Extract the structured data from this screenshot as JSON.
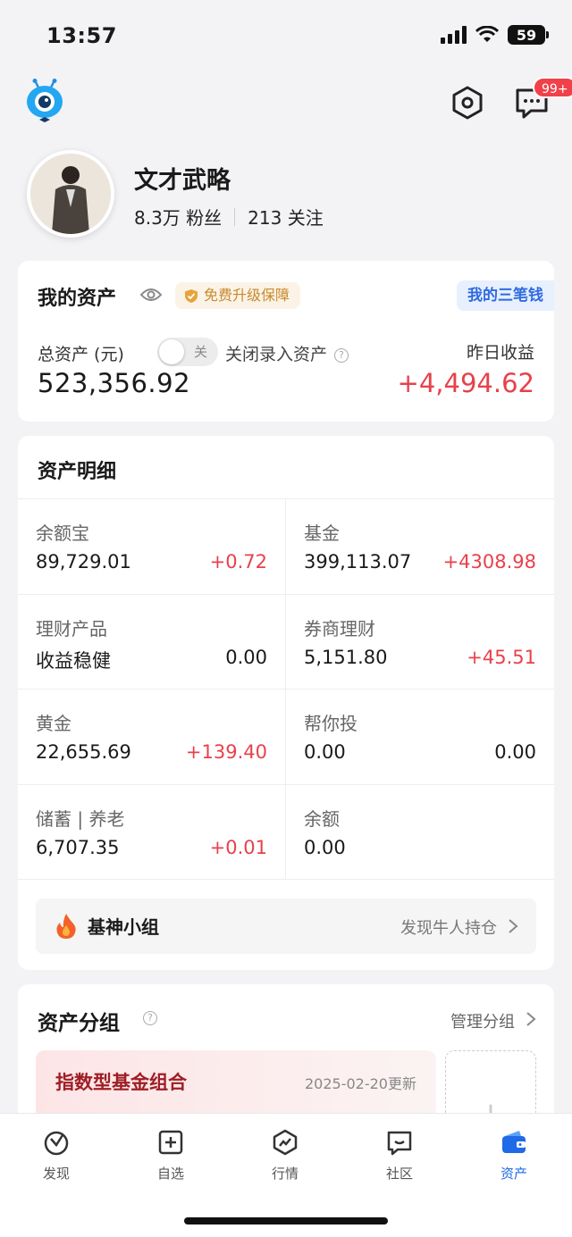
{
  "status_bar": {
    "time": "13:57",
    "battery": "59"
  },
  "header": {
    "message_badge": "99+"
  },
  "profile": {
    "name": "文才武略",
    "fans": "8.3万 粉丝",
    "following": "213 关注"
  },
  "assets": {
    "title": "我的资产",
    "protect_badge": "免费升级保障",
    "three_money": "我的三笔钱",
    "total_label": "总资产 (元)",
    "toggle_text": "关",
    "toggle_label": "关闭录入资产",
    "total_value": "523,356.92",
    "yesterday_label": "昨日收益",
    "yesterday_value": "+4,494.62"
  },
  "detail": {
    "title": "资产明细",
    "items": [
      {
        "name": "余额宝",
        "value": "89,729.01",
        "change": "+0.72"
      },
      {
        "name": "基金",
        "value": "399,113.07",
        "change": "+4308.98"
      },
      {
        "name": "理财产品",
        "value": "收益稳健",
        "change": "0.00"
      },
      {
        "name": "券商理财",
        "value": "5,151.80",
        "change": "+45.51"
      },
      {
        "name": "黄金",
        "value": "22,655.69",
        "change": "+139.40"
      },
      {
        "name": "帮你投",
        "value": "0.00",
        "change": "0.00"
      },
      {
        "name": "储蓄 | 养老",
        "value": "6,707.35",
        "change": "+0.01"
      },
      {
        "name": "余额",
        "value": "0.00",
        "change": ""
      }
    ],
    "jishen_label": "基神小组",
    "jishen_link": "发现牛人持仓"
  },
  "groups": {
    "title": "资产分组",
    "manage": "管理分组",
    "item_name": "指数型基金组合",
    "item_date": "2025-02-20更新",
    "add": "+"
  },
  "tabs": [
    {
      "label": "发现",
      "icon": "discover-icon"
    },
    {
      "label": "自选",
      "icon": "watchlist-icon"
    },
    {
      "label": "行情",
      "icon": "market-icon"
    },
    {
      "label": "社区",
      "icon": "community-icon"
    },
    {
      "label": "资产",
      "icon": "wallet-icon"
    }
  ],
  "colors": {
    "accent": "#1f6ae6",
    "gain": "#e8414b",
    "badge": "#f0414a"
  }
}
